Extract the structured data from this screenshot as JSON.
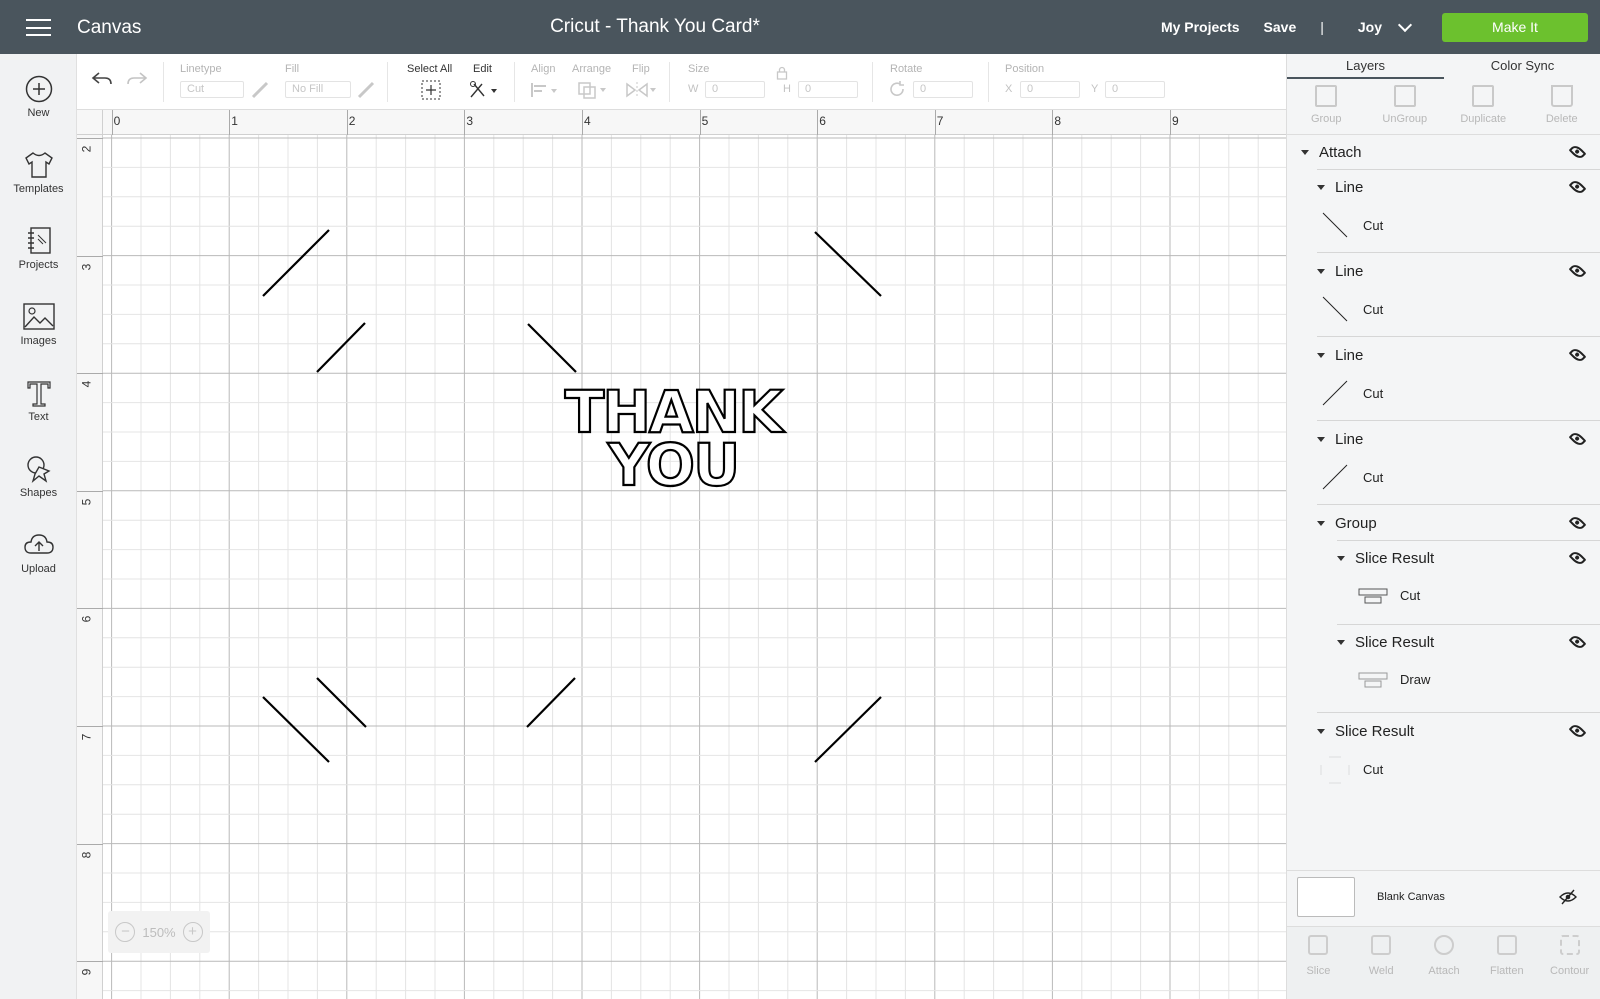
{
  "header": {
    "app_title": "Canvas",
    "doc_title": "Cricut - Thank You Card*",
    "my_projects": "My Projects",
    "save": "Save",
    "separator": "|",
    "user": "Joy",
    "make_it": "Make It"
  },
  "sidebar": {
    "items": [
      {
        "label": "New",
        "icon": "plus-circle-icon"
      },
      {
        "label": "Templates",
        "icon": "tshirt-icon"
      },
      {
        "label": "Projects",
        "icon": "notebook-icon"
      },
      {
        "label": "Images",
        "icon": "image-icon"
      },
      {
        "label": "Text",
        "icon": "text-icon"
      },
      {
        "label": "Shapes",
        "icon": "shapes-icon"
      },
      {
        "label": "Upload",
        "icon": "cloud-upload-icon"
      }
    ]
  },
  "toolbar": {
    "linetype_label": "Linetype",
    "linetype_value": "Cut",
    "fill_label": "Fill",
    "fill_value": "No Fill",
    "select_all": "Select All",
    "edit": "Edit",
    "align": "Align",
    "arrange": "Arrange",
    "flip": "Flip",
    "size": "Size",
    "w_label": "W",
    "w_value": "0",
    "h_label": "H",
    "h_value": "0",
    "rotate": "Rotate",
    "rotate_value": "0",
    "position": "Position",
    "x_label": "X",
    "x_value": "0",
    "y_label": "Y",
    "y_value": "0"
  },
  "canvas": {
    "ruler_top": [
      "0",
      "1",
      "2",
      "3",
      "4",
      "5",
      "6",
      "7",
      "8",
      "9"
    ],
    "ruler_left": [
      "2",
      "3",
      "4",
      "5",
      "6",
      "7",
      "8",
      "9"
    ],
    "design_text_line1": "THANK",
    "design_text_line2": "YOU",
    "zoom_minus": "−",
    "zoom_value": "150%",
    "zoom_plus": "+"
  },
  "panel": {
    "tabs": [
      "Layers",
      "Color Sync"
    ],
    "actions": [
      "Group",
      "UnGroup",
      "Duplicate",
      "Delete"
    ],
    "layers": {
      "attach": "Attach",
      "line1": "Line",
      "line1_op": "Cut",
      "line2": "Line",
      "line2_op": "Cut",
      "line3": "Line",
      "line3_op": "Cut",
      "line4": "Line",
      "line4_op": "Cut",
      "group": "Group",
      "slice1": "Slice Result",
      "slice1_op": "Cut",
      "slice2": "Slice Result",
      "slice2_op": "Draw",
      "slice3": "Slice Result",
      "slice3_op": "Cut"
    },
    "blank_canvas": "Blank Canvas",
    "bottom_actions": [
      "Slice",
      "Weld",
      "Attach",
      "Flatten",
      "Contour"
    ]
  },
  "colors": {
    "header_bg": "#4a555d",
    "make_it_green": "#6cc12e",
    "panel_bg": "#f4f5f6"
  }
}
